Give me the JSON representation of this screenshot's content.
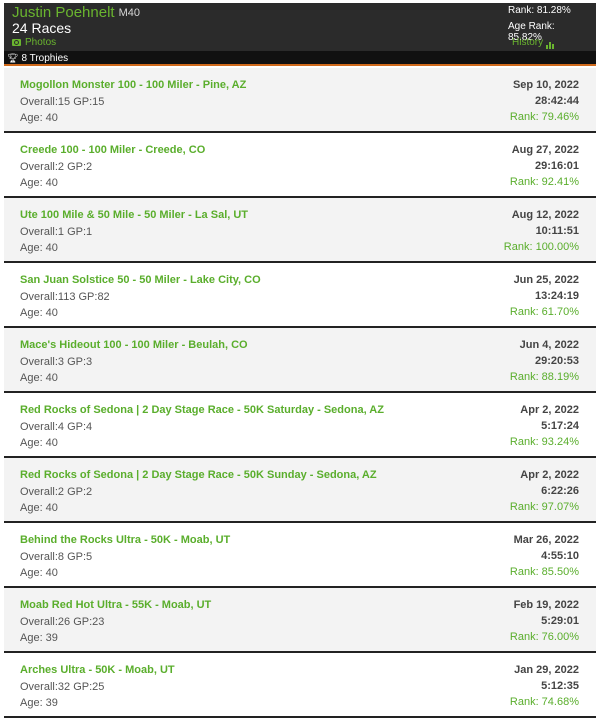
{
  "profile": {
    "name": "Justin Poehnelt",
    "category": "M40",
    "races_count": "24 Races",
    "photos_label": "Photos",
    "rank": "Rank: 81.28%",
    "age_rank": "Age Rank: 85.82%",
    "history_label": "History",
    "trophies": "8 Trophies"
  },
  "colors": {
    "accent": "#5aae2c",
    "header_bg": "#2b2b2b",
    "divider": "#d06a1c"
  },
  "races": [
    {
      "title": "Mogollon Monster 100 - 100 Miler - Pine, AZ",
      "overall": "Overall:15 GP:15",
      "age": "Age: 40",
      "date": "Sep 10, 2022",
      "time": "28:42:44",
      "rank": "Rank: 79.46%"
    },
    {
      "title": "Creede 100 - 100 Miler - Creede, CO",
      "overall": "Overall:2 GP:2",
      "age": "Age: 40",
      "date": "Aug 27, 2022",
      "time": "29:16:01",
      "rank": "Rank: 92.41%"
    },
    {
      "title": "Ute 100 Mile & 50 Mile - 50 Miler - La Sal, UT",
      "overall": "Overall:1 GP:1",
      "age": "Age: 40",
      "date": "Aug 12, 2022",
      "time": "10:11:51",
      "rank": "Rank: 100.00%"
    },
    {
      "title": "San Juan Solstice 50 - 50 Miler - Lake City, CO",
      "overall": "Overall:113 GP:82",
      "age": "Age: 40",
      "date": "Jun 25, 2022",
      "time": "13:24:19",
      "rank": "Rank: 61.70%"
    },
    {
      "title": "Mace's Hideout 100 - 100 Miler - Beulah, CO",
      "overall": "Overall:3 GP:3",
      "age": "Age: 40",
      "date": "Jun 4, 2022",
      "time": "29:20:53",
      "rank": "Rank: 88.19%"
    },
    {
      "title": "Red Rocks of Sedona | 2 Day Stage Race - 50K Saturday - Sedona, AZ",
      "overall": "Overall:4 GP:4",
      "age": "Age: 40",
      "date": "Apr 2, 2022",
      "time": "5:17:24",
      "rank": "Rank: 93.24%"
    },
    {
      "title": "Red Rocks of Sedona | 2 Day Stage Race - 50K Sunday - Sedona, AZ",
      "overall": "Overall:2 GP:2",
      "age": "Age: 40",
      "date": "Apr 2, 2022",
      "time": "6:22:26",
      "rank": "Rank: 97.07%"
    },
    {
      "title": "Behind the Rocks Ultra - 50K - Moab, UT",
      "overall": "Overall:8 GP:5",
      "age": "Age: 40",
      "date": "Mar 26, 2022",
      "time": "4:55:10",
      "rank": "Rank: 85.50%"
    },
    {
      "title": "Moab Red Hot Ultra - 55K - Moab, UT",
      "overall": "Overall:26 GP:23",
      "age": "Age: 39",
      "date": "Feb 19, 2022",
      "time": "5:29:01",
      "rank": "Rank: 76.00%"
    },
    {
      "title": "Arches Ultra - 50K - Moab, UT",
      "overall": "Overall:32 GP:25",
      "age": "Age: 39",
      "date": "Jan 29, 2022",
      "time": "5:12:35",
      "rank": "Rank: 74.68%"
    }
  ]
}
